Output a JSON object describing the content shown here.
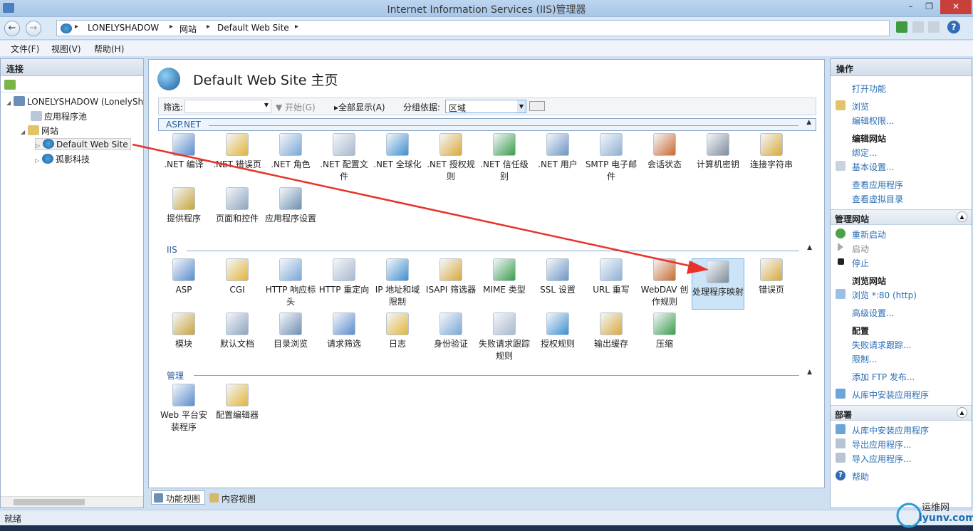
{
  "window": {
    "title": "Internet Information Services (IIS)管理器"
  },
  "breadcrumb": [
    "LONELYSHADOW",
    "网站",
    "Default Web Site"
  ],
  "menu": [
    "文件(F)",
    "视图(V)",
    "帮助(H)"
  ],
  "connections": {
    "header": "连接",
    "tree": [
      {
        "label": "LONELYSHADOW (LonelySh"
      },
      {
        "label": "应用程序池"
      },
      {
        "label": "网站"
      },
      {
        "label": "Default Web Site"
      },
      {
        "label": "孤影科技"
      }
    ]
  },
  "page": {
    "title": "Default Web Site 主页"
  },
  "toolbar": {
    "filter_label": "筛选:",
    "start": "开始(G)",
    "show_all": "全部显示(A)",
    "group_by": "分组依据:",
    "group_value": "区域"
  },
  "groups": {
    "aspnet": {
      "title": "ASP.NET",
      "features": [
        ".NET 编译",
        ".NET 错误页",
        ".NET 角色",
        ".NET 配置文件",
        ".NET 全球化",
        ".NET 授权规则",
        ".NET 信任级别",
        ".NET 用户",
        "SMTP 电子邮件",
        "会话状态",
        "计算机密钥",
        "连接字符串",
        "提供程序",
        "页面和控件",
        "应用程序设置"
      ]
    },
    "iis": {
      "title": "IIS",
      "features": [
        "ASP",
        "CGI",
        "HTTP 响应标头",
        "HTTP 重定向",
        "IP 地址和域限制",
        "ISAPI 筛选器",
        "MIME 类型",
        "SSL 设置",
        "URL 重写",
        "WebDAV 创作规则",
        "处理程序映射",
        "错误页",
        "模块",
        "默认文档",
        "目录浏览",
        "请求筛选",
        "日志",
        "身份验证",
        "失败请求跟踪规则",
        "授权规则",
        "输出缓存",
        "压缩"
      ]
    },
    "mgmt": {
      "title": "管理",
      "features": [
        "Web 平台安装程序",
        "配置编辑器"
      ]
    }
  },
  "actions": {
    "header": "操作",
    "open_feature": "打开功能",
    "browse": "浏览",
    "edit_perms": "编辑权限...",
    "edit_site": "编辑网站",
    "bindings": "绑定...",
    "basic_settings": "基本设置...",
    "view_apps": "查看应用程序",
    "view_vdirs": "查看虚拟目录",
    "manage_site": "管理网站",
    "restart": "重新启动",
    "start": "启动",
    "stop": "停止",
    "browse_site": "浏览网站",
    "browse_80": "浏览 *:80 (http)",
    "advanced": "高级设置...",
    "config": "配置",
    "failed_req": "失败请求跟踪...",
    "limits": "限制...",
    "add_ftp": "添加 FTP 发布...",
    "install_gallery": "从库中安装应用程序",
    "deploy": "部署",
    "install_gallery2": "从库中安装应用程序",
    "export_app": "导出应用程序...",
    "import_app": "导入应用程序...",
    "help": "帮助"
  },
  "views": {
    "features": "功能视图",
    "content": "内容视图"
  },
  "status": "就绪",
  "watermark": {
    "line1": "运维网",
    "line2": "iyunv.com"
  }
}
